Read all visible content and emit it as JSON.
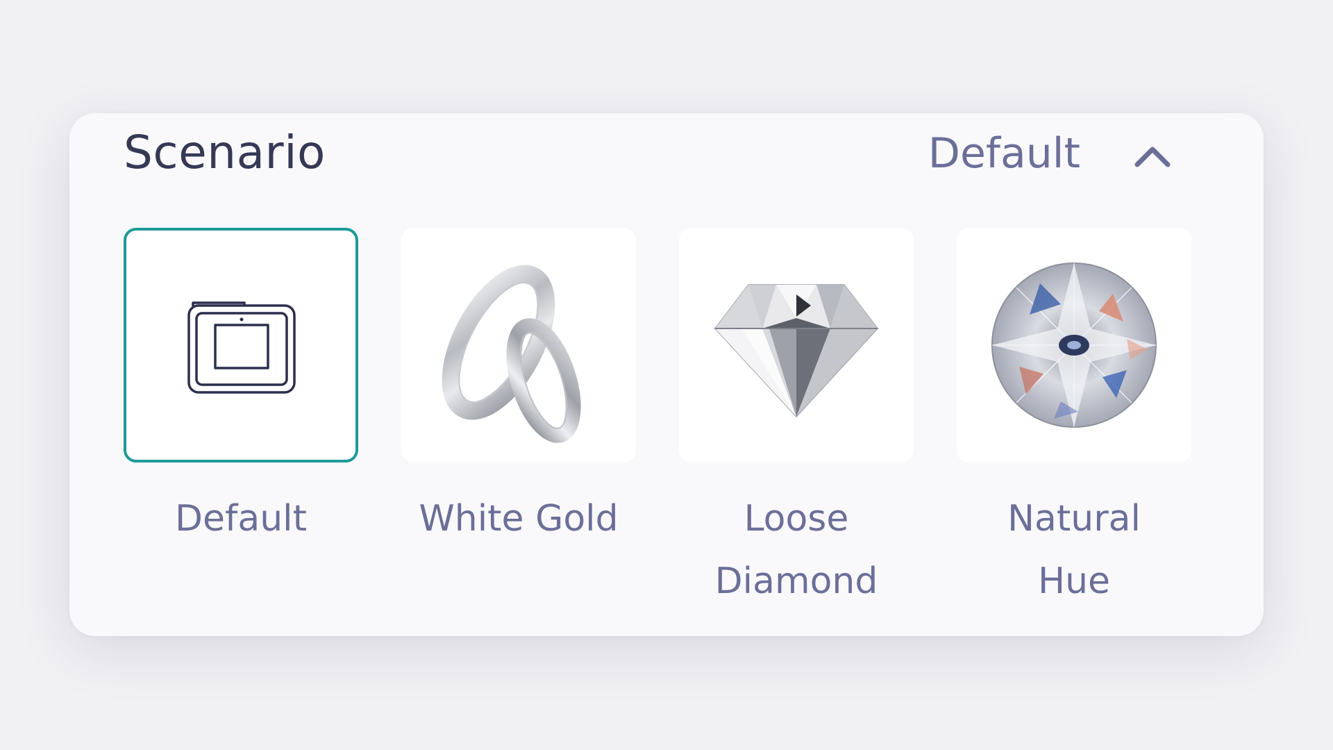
{
  "panel": {
    "title": "Scenario",
    "selected_value": "Default",
    "collapse_icon": "chevron-up-icon"
  },
  "scenarios": [
    {
      "label": "Default",
      "icon": "device-frame-icon",
      "selected": true
    },
    {
      "label": "White Gold",
      "icon": "ring-pair-image",
      "selected": false
    },
    {
      "label": "Loose Diamond",
      "icon": "diamond-side-image",
      "selected": false
    },
    {
      "label": "Natural Hue",
      "icon": "diamond-top-image",
      "selected": false
    }
  ],
  "colors": {
    "selected_border": "#1d9a98",
    "title_text": "#363955",
    "label_text": "#6b6f98",
    "panel_bg": "#f9f9fc"
  }
}
